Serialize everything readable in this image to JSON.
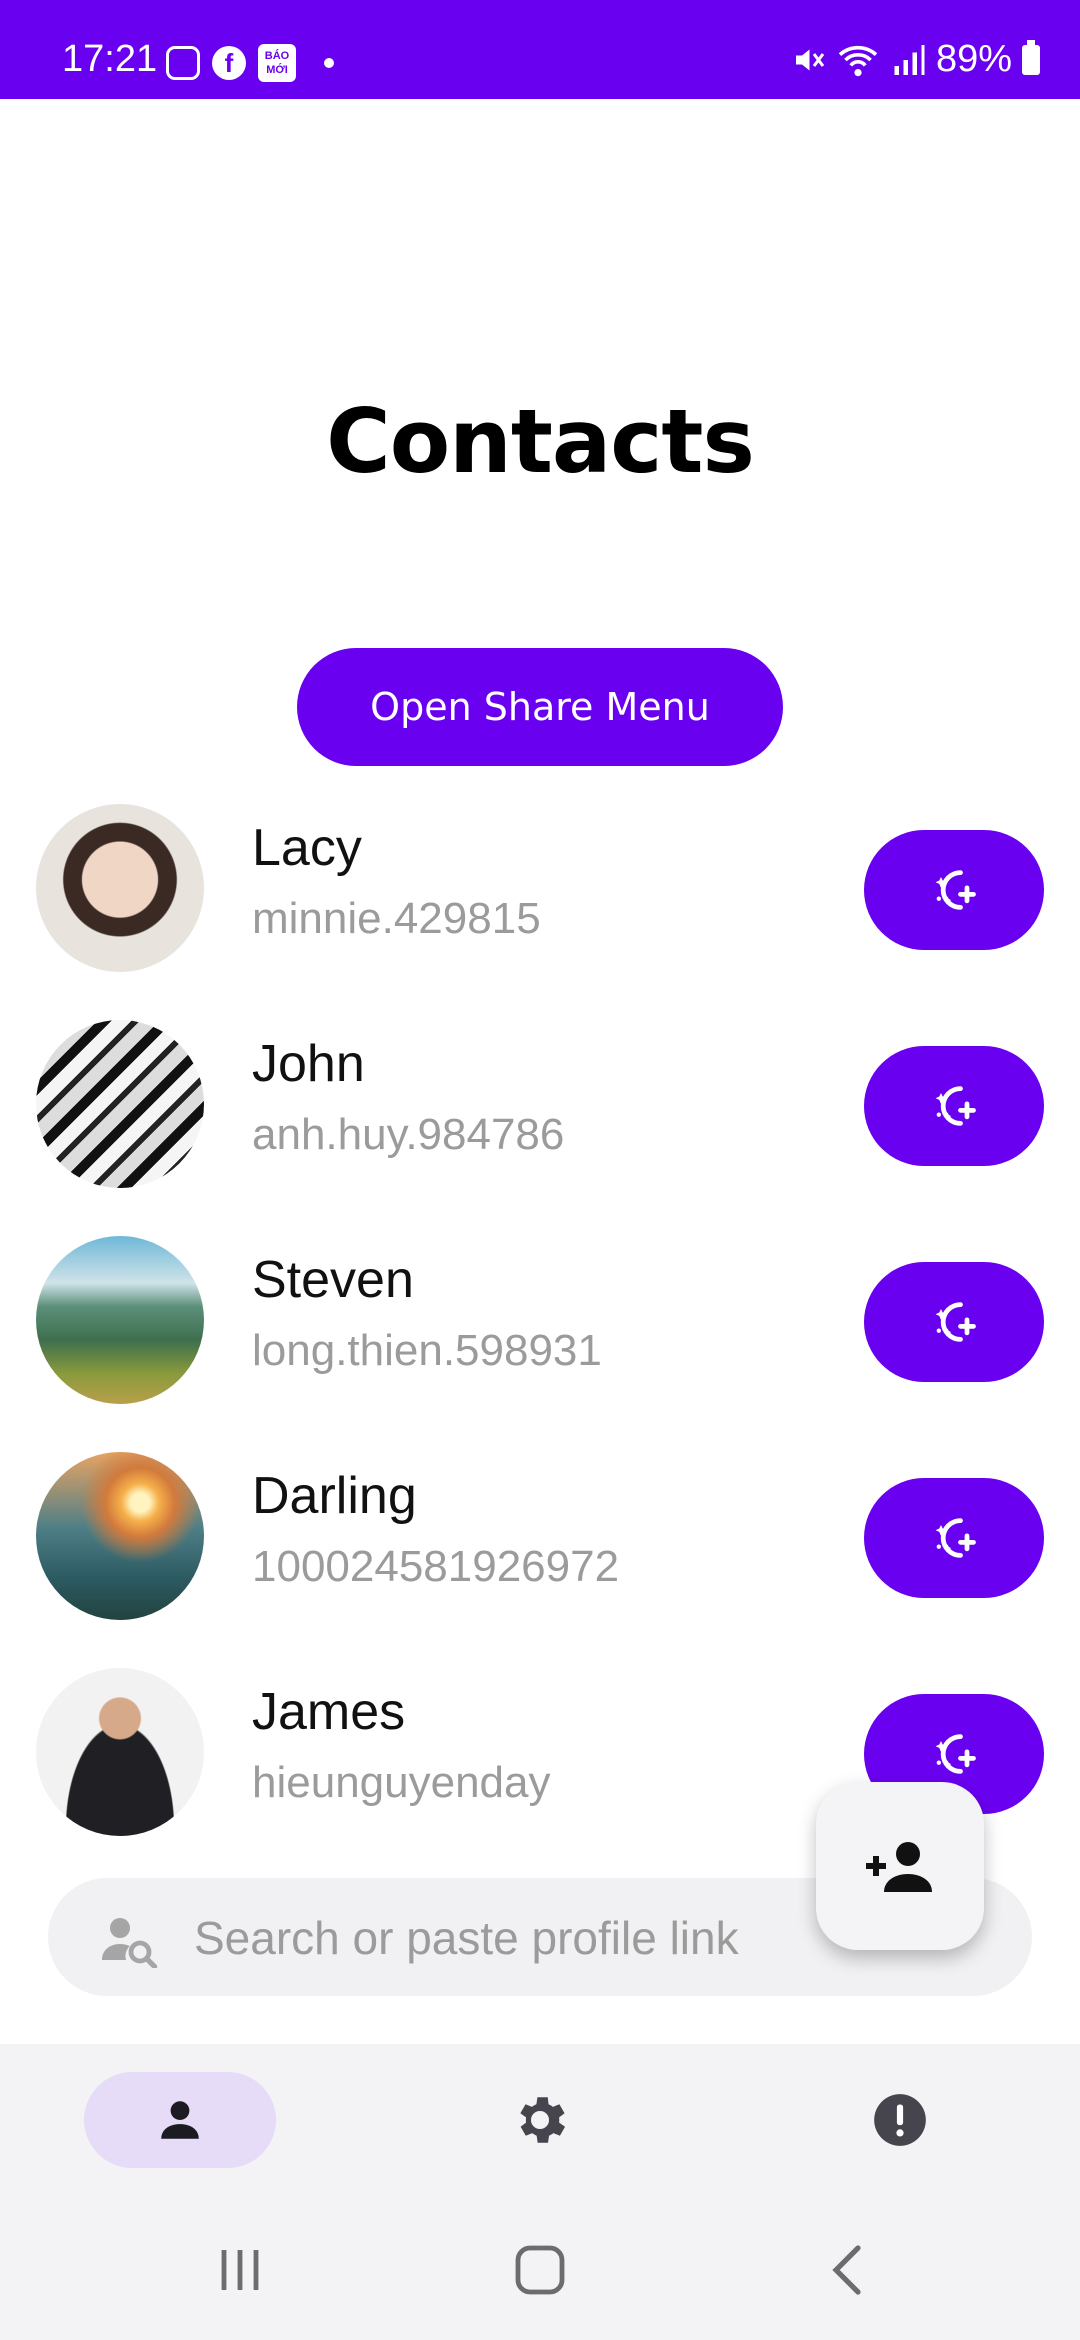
{
  "status_bar": {
    "time": "17:21",
    "baomoi_label": "BÁO MỚI",
    "fb_glyph": "f",
    "battery": "89%"
  },
  "page": {
    "title": "Contacts",
    "share_button": "Open Share Menu"
  },
  "contacts": [
    {
      "name": "Lacy",
      "id": "minnie.429815"
    },
    {
      "name": "John",
      "id": "anh.huy.984786"
    },
    {
      "name": "Steven",
      "id": "long.thien.598931"
    },
    {
      "name": "Darling",
      "id": "100024581926972"
    },
    {
      "name": "James",
      "id": "hieunguyenday"
    }
  ],
  "search": {
    "placeholder": "Search or paste profile link"
  },
  "colors": {
    "accent": "#6a00f0",
    "muted_text": "#9b9b9b",
    "nav_active_bg": "#e6dcf8"
  },
  "bottom_nav": {
    "items": [
      "person-icon",
      "gear-icon",
      "alert-icon"
    ],
    "active": 0
  }
}
